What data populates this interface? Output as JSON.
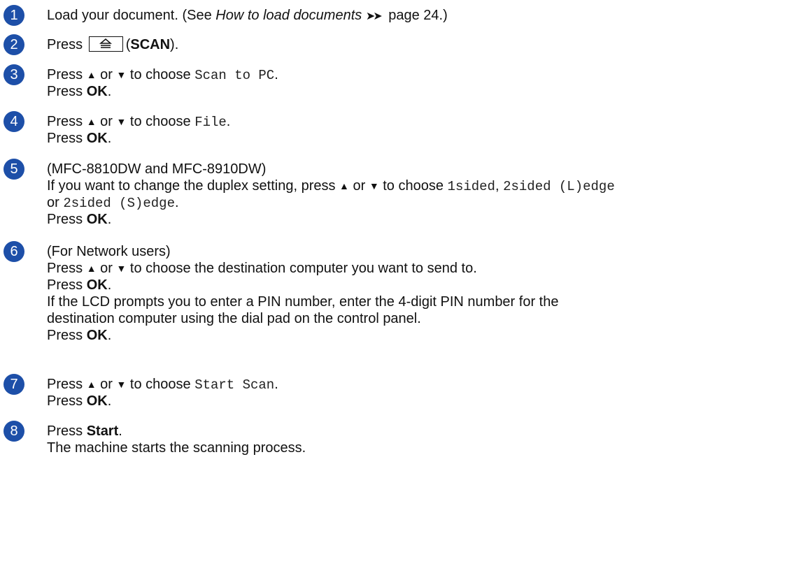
{
  "steps": [
    {
      "number": "1",
      "l1_prefix": "Load your document. (See ",
      "l1_link": "How to load documents",
      "l1_arrows": "➤➤",
      "l1_suffix": " page 24.)"
    },
    {
      "number": "2",
      "press": "Press",
      "key_label_open": "(",
      "key_label": "SCAN",
      "key_label_close": ")."
    },
    {
      "number": "3",
      "press": "Press",
      "or": "or",
      "to_choose": "to choose",
      "option": "Scan to PC",
      "end": ".",
      "press_ok": "Press",
      "ok": "OK"
    },
    {
      "number": "4",
      "press": "Press",
      "or": "or",
      "to_choose": "to choose",
      "option": "File",
      "end": ".",
      "press_ok": "Press",
      "ok": "OK"
    },
    {
      "number": "5",
      "models": "(MFC-8810DW and MFC-8910DW)",
      "l2_prefix": "If you want to change the duplex setting, press",
      "or": "or",
      "to_choose": "to choose",
      "opt1": "1sided",
      "opt2": "2sided (L)edge",
      "l3_or": "or",
      "opt3": "2sided (S)edge",
      "end": ".",
      "press_ok": "Press",
      "ok": "OK"
    },
    {
      "number": "6",
      "users": "(For Network users)",
      "press": "Press",
      "or": "or",
      "l2_suffix": "to choose the destination computer you want to send to.",
      "press_ok": "Press",
      "ok": "OK",
      "pin_line1": "If the LCD prompts you to enter a PIN number, enter the 4-digit PIN number for the",
      "pin_line2": "destination computer using the dial pad on the control panel.",
      "press_ok2": "Press",
      "ok2": "OK"
    },
    {
      "number": "7",
      "press": "Press",
      "or": "or",
      "to_choose": "to choose",
      "option": "Start Scan",
      "end": ".",
      "press_ok": "Press",
      "ok": "OK"
    },
    {
      "number": "8",
      "press": "Press",
      "start": "Start",
      "result": "The machine starts the scanning process."
    }
  ],
  "colors": {
    "step_badge": "#1d4fa8"
  },
  "icons": {
    "up": "up-triangle-icon",
    "down": "down-triangle-icon",
    "scan_key": "scan-key-icon"
  }
}
